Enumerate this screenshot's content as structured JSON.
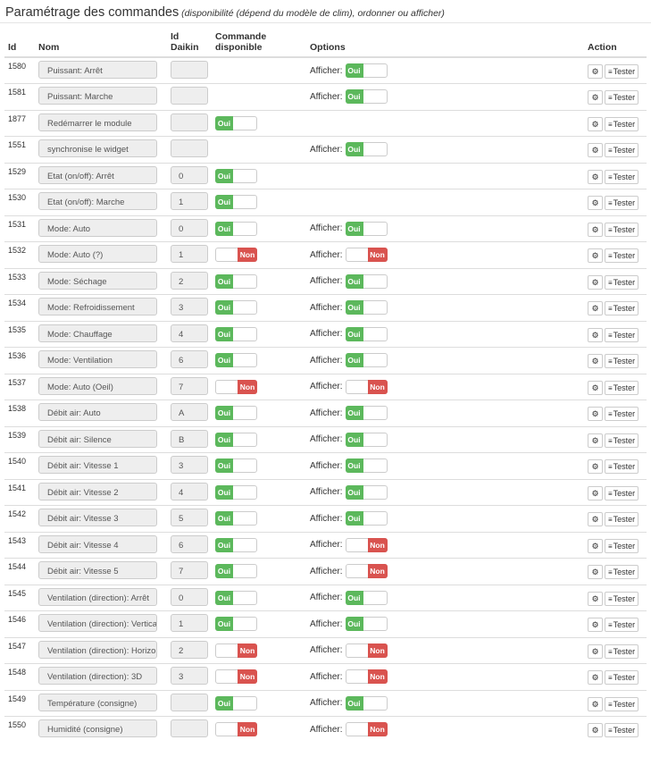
{
  "header": {
    "title": "Paramétrage des commandes",
    "subtitle": "(disponibilité (dépend du modèle de clim), ordonner ou afficher)"
  },
  "columns": {
    "id": "Id",
    "nom": "Nom",
    "id_daikin": "Id Daikin",
    "commande": "Commande disponible",
    "options": "Options",
    "action": "Action"
  },
  "labels": {
    "afficher": "Afficher:",
    "oui": "Oui",
    "non": "Non",
    "tester": "Tester",
    "config_icon": "gears-icon",
    "test_icon": "rss-icon"
  },
  "colors": {
    "oui": "#5cb85c",
    "non": "#d9534f"
  },
  "rows": [
    {
      "id": "1580",
      "nom": "Puissant: Arrêt",
      "daikin": "",
      "cmd": null,
      "afficher": "on"
    },
    {
      "id": "1581",
      "nom": "Puissant: Marche",
      "daikin": "",
      "cmd": null,
      "afficher": "on"
    },
    {
      "id": "1877",
      "nom": "Redémarrer le module",
      "daikin": "",
      "cmd": "on",
      "afficher": null
    },
    {
      "id": "1551",
      "nom": "synchronise le widget",
      "daikin": "",
      "cmd": null,
      "afficher": "on"
    },
    {
      "id": "1529",
      "nom": "Etat (on/off): Arrêt",
      "daikin": "0",
      "cmd": "on",
      "afficher": null
    },
    {
      "id": "1530",
      "nom": "Etat (on/off): Marche",
      "daikin": "1",
      "cmd": "on",
      "afficher": null
    },
    {
      "id": "1531",
      "nom": "Mode: Auto",
      "daikin": "0",
      "cmd": "on",
      "afficher": "on"
    },
    {
      "id": "1532",
      "nom": "Mode: Auto (?)",
      "daikin": "1",
      "cmd": "off",
      "afficher": "off"
    },
    {
      "id": "1533",
      "nom": "Mode: Séchage",
      "daikin": "2",
      "cmd": "on",
      "afficher": "on"
    },
    {
      "id": "1534",
      "nom": "Mode: Refroidissement",
      "daikin": "3",
      "cmd": "on",
      "afficher": "on"
    },
    {
      "id": "1535",
      "nom": "Mode: Chauffage",
      "daikin": "4",
      "cmd": "on",
      "afficher": "on"
    },
    {
      "id": "1536",
      "nom": "Mode: Ventilation",
      "daikin": "6",
      "cmd": "on",
      "afficher": "on"
    },
    {
      "id": "1537",
      "nom": "Mode: Auto (Oeil)",
      "daikin": "7",
      "cmd": "off",
      "afficher": "off"
    },
    {
      "id": "1538",
      "nom": "Débit air: Auto",
      "daikin": "A",
      "cmd": "on",
      "afficher": "on"
    },
    {
      "id": "1539",
      "nom": "Débit air: Silence",
      "daikin": "B",
      "cmd": "on",
      "afficher": "on"
    },
    {
      "id": "1540",
      "nom": "Débit air: Vitesse 1",
      "daikin": "3",
      "cmd": "on",
      "afficher": "on"
    },
    {
      "id": "1541",
      "nom": "Débit air: Vitesse 2",
      "daikin": "4",
      "cmd": "on",
      "afficher": "on"
    },
    {
      "id": "1542",
      "nom": "Débit air: Vitesse 3",
      "daikin": "5",
      "cmd": "on",
      "afficher": "on"
    },
    {
      "id": "1543",
      "nom": "Débit air: Vitesse 4",
      "daikin": "6",
      "cmd": "on",
      "afficher": "off"
    },
    {
      "id": "1544",
      "nom": "Débit air: Vitesse 5",
      "daikin": "7",
      "cmd": "on",
      "afficher": "off"
    },
    {
      "id": "1545",
      "nom": "Ventilation (direction): Arrêt",
      "daikin": "0",
      "cmd": "on",
      "afficher": "on"
    },
    {
      "id": "1546",
      "nom": "Ventilation (direction): Vertical",
      "daikin": "1",
      "cmd": "on",
      "afficher": "on"
    },
    {
      "id": "1547",
      "nom": "Ventilation (direction): Horizon",
      "daikin": "2",
      "cmd": "off",
      "afficher": "off"
    },
    {
      "id": "1548",
      "nom": "Ventilation (direction): 3D",
      "daikin": "3",
      "cmd": "off",
      "afficher": "off"
    },
    {
      "id": "1549",
      "nom": "Température (consigne)",
      "daikin": "",
      "cmd": "on",
      "afficher": "on"
    },
    {
      "id": "1550",
      "nom": "Humidité (consigne)",
      "daikin": "",
      "cmd": "off",
      "afficher": "off"
    }
  ]
}
